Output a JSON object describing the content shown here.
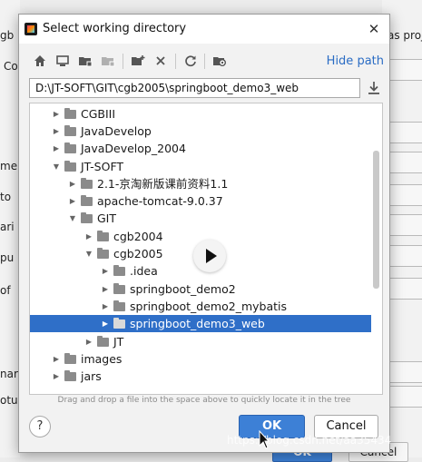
{
  "background": {
    "left_fragments": [
      "gb",
      "Co",
      "me",
      "to",
      "ari",
      "pu",
      "of",
      "nar",
      "otu"
    ],
    "right_fragments": [
      "as proj"
    ],
    "bottom_ok_label": "OK",
    "bottom_cancel_label": "Cancel"
  },
  "dialog": {
    "title": "Select working directory",
    "close_glyph": "✕",
    "toolbar": {
      "hide_path_label": "Hide path",
      "icons": [
        "home-icon",
        "desktop-icon",
        "project-folder-icon",
        "module-folder-icon",
        "new-folder-icon",
        "delete-icon",
        "refresh-icon",
        "show-hidden-icon"
      ]
    },
    "path": "D:\\JT-SOFT\\GIT\\cgb2005\\springboot_demo3_web",
    "tree": [
      {
        "label": "CGBIII",
        "expanded": false
      },
      {
        "label": "JavaDevelop",
        "expanded": false
      },
      {
        "label": "JavaDevelop_2004",
        "expanded": false
      },
      {
        "label": "JT-SOFT",
        "expanded": true
      },
      {
        "label": "2.1-京淘新版课前资料1.1",
        "expanded": false
      },
      {
        "label": "apache-tomcat-9.0.37",
        "expanded": false
      },
      {
        "label": "GIT",
        "expanded": true
      },
      {
        "label": "cgb2004",
        "expanded": false
      },
      {
        "label": "cgb2005",
        "expanded": true
      },
      {
        "label": ".idea",
        "expanded": false
      },
      {
        "label": "springboot_demo2",
        "expanded": false
      },
      {
        "label": "springboot_demo2_mybatis",
        "expanded": false
      },
      {
        "label": "springboot_demo3_web",
        "expanded": false,
        "selected": true
      },
      {
        "label": "JT",
        "expanded": false
      },
      {
        "label": "images",
        "expanded": false
      },
      {
        "label": "jars",
        "expanded": false
      }
    ],
    "hint": "Drag and drop a file into the space above to quickly locate it in the tree",
    "help_label": "?",
    "ok_label": "OK",
    "cancel_label": "Cancel"
  },
  "watermark": "https://blog.csdn.net/aa35434",
  "colors": {
    "accent": "#2f6fc8",
    "link": "#2a6cc4",
    "ok_button": "#3d80d6"
  }
}
